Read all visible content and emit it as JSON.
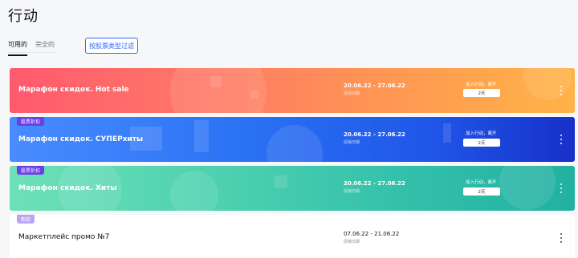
{
  "page": {
    "title": "行动"
  },
  "tabs": [
    {
      "label": "可用的",
      "active": true
    },
    {
      "label": "完全的",
      "active": false
    }
  ],
  "filter_button": {
    "label": "按股票类型过滤"
  },
  "promotions": [
    {
      "badge": "",
      "name": "Марафон скидок. Hot sale",
      "dates": "20.06.22 - 27.06.22",
      "dates_caption": "促销日期",
      "join_label": "加入行动，离开",
      "days": "2天",
      "theme": "coral"
    },
    {
      "badge": "股票折扣",
      "name": "Марафон скидок. СУПЕРхиты",
      "dates": "20.06.22 - 27.06.22",
      "dates_caption": "促销日期",
      "join_label": "加入行动，离开",
      "days": "2天",
      "theme": "blue"
    },
    {
      "badge": "股票折扣",
      "name": "Марафон скидок. Хиты",
      "dates": "20.06.22 - 27.06.22",
      "dates_caption": "促销日期",
      "join_label": "加入行动，离开",
      "days": "2天",
      "theme": "teal"
    },
    {
      "badge": "新款",
      "name": "Маркетплейс промо №7",
      "dates": "07.06.22 - 21.06.22",
      "dates_caption": "促销日期",
      "theme": "white"
    }
  ],
  "colors": {
    "accent": "#2f6bff",
    "badge_dark": "#6a3de8",
    "badge_light": "#b9a5f5"
  }
}
